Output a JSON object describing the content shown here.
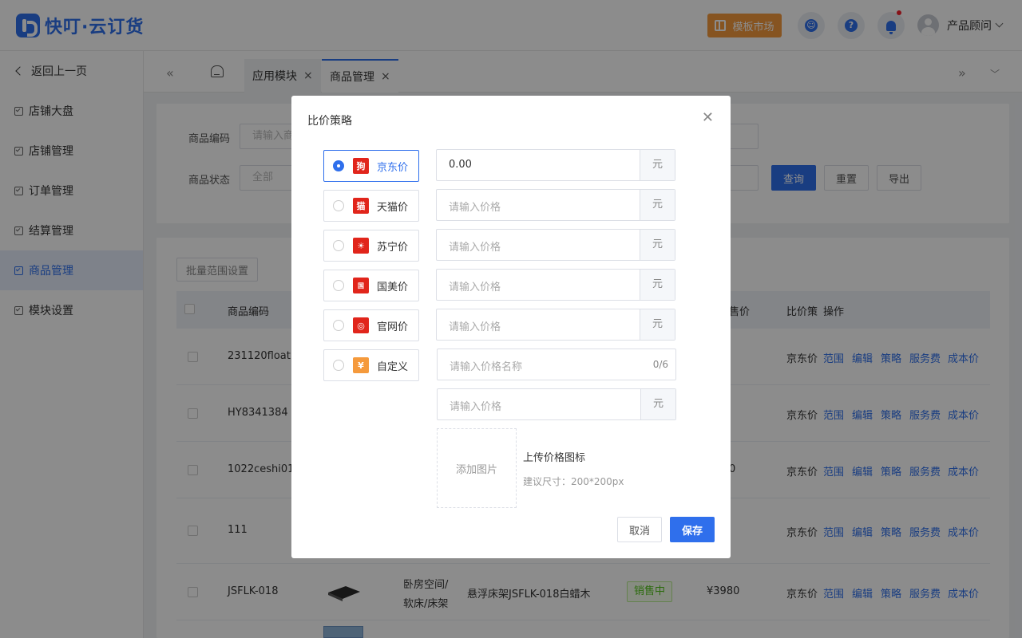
{
  "app": {
    "logo_text": "快叮·云订货"
  },
  "header": {
    "template_market": "模板市场",
    "user_name": "产品顾问"
  },
  "sidebar": {
    "back": "返回上一页",
    "items": [
      {
        "label": "店铺大盘"
      },
      {
        "label": "店铺管理"
      },
      {
        "label": "订单管理"
      },
      {
        "label": "结算管理"
      },
      {
        "label": "商品管理"
      },
      {
        "label": "模块设置"
      }
    ]
  },
  "tabs": [
    {
      "label": "应用模块"
    },
    {
      "label": "商品管理"
    }
  ],
  "filters": {
    "code_label": "商品编码",
    "code_placeholder": "请输入商品",
    "status_label": "商品状态",
    "status_value": "全部",
    "query": "查询",
    "reset": "重置",
    "export": "导出"
  },
  "batch_button": "批量范围设置",
  "table": {
    "headers": {
      "code": "商品编码",
      "price": "售价",
      "strategy": "比价策",
      "ops": "操作"
    },
    "rows": [
      {
        "code": "231120float",
        "strategy": "京东价"
      },
      {
        "code": "HY8341384",
        "strategy": "京东价"
      },
      {
        "code": "1022ceshi01",
        "price": "0",
        "strategy": "京东价"
      },
      {
        "code": "111",
        "strategy": "京东价"
      },
      {
        "code": "JSFLK-018",
        "category_line1": "卧房空间/",
        "category_line2": "软床/床架",
        "name": "悬浮床架JSFLK-018白蜡木",
        "status": "销售中",
        "price": "¥3980",
        "strategy": "京东价"
      }
    ],
    "ops": [
      "范围",
      "编辑",
      "策略",
      "服务费",
      "成本价"
    ]
  },
  "modal": {
    "title": "比价策略",
    "options": [
      {
        "label": "京东价",
        "icon": "jd-icon",
        "color": "#e1251b"
      },
      {
        "label": "天猫价",
        "icon": "tmall-icon",
        "color": "#e1251b"
      },
      {
        "label": "苏宁价",
        "icon": "suning-icon",
        "color": "#e1251b"
      },
      {
        "label": "国美价",
        "icon": "gome-icon",
        "color": "#e1251b"
      },
      {
        "label": "官网价",
        "icon": "globe-icon",
        "color": "#e1251b"
      },
      {
        "label": "自定义",
        "icon": "custom-icon",
        "color": "#f59a3c"
      }
    ],
    "jd_value": "0.00",
    "price_placeholder": "请输入价格",
    "unit": "元",
    "name_placeholder": "请输入价格名称",
    "name_count": "0/6",
    "upload_label": "添加图片",
    "upload_title": "上传价格图标",
    "upload_hint": "建议尺寸：200*200px",
    "cancel": "取消",
    "save": "保存"
  }
}
